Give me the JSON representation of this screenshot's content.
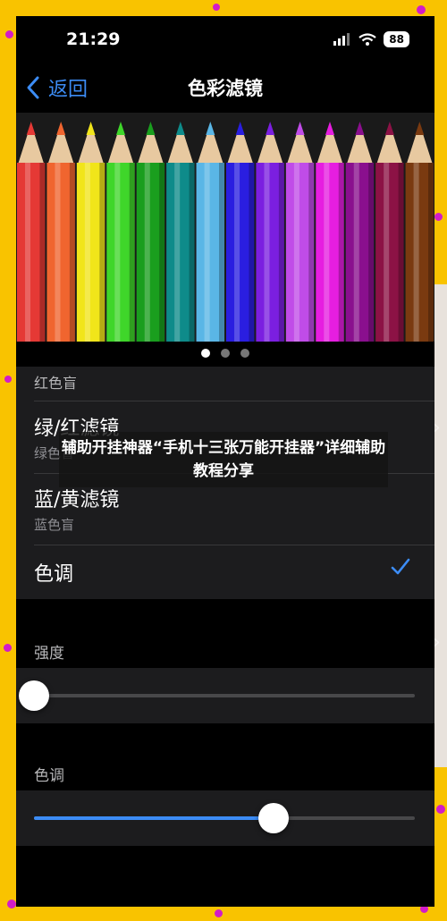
{
  "status_bar": {
    "time": "21:29",
    "battery": "88"
  },
  "nav": {
    "back_label": "返回",
    "title": "色彩滤镜"
  },
  "carousel": {
    "pencil_colors": [
      "#e53935",
      "#f0652f",
      "#f1e51a",
      "#3fd62a",
      "#1a9e1e",
      "#0e8b8a",
      "#5ab6e6",
      "#2a1ee0",
      "#7b1fe0",
      "#c04ce8",
      "#e61ee0",
      "#8a0f8e",
      "#8c1245",
      "#7a3a10"
    ],
    "page_count": 3,
    "active_page": 1
  },
  "options": [
    {
      "title": "",
      "subtitle": "红色盲",
      "selected": false
    },
    {
      "title": "绿/红滤镜",
      "subtitle": "绿色盲",
      "selected": false
    },
    {
      "title": "蓝/黄滤镜",
      "subtitle": "蓝色盲",
      "selected": false
    },
    {
      "title": "色调",
      "subtitle": "",
      "selected": true
    }
  ],
  "sliders": {
    "intensity": {
      "label": "强度",
      "value": 0.0
    },
    "hue": {
      "label": "色调",
      "value": 0.63
    }
  },
  "overlay_banner": "辅助开挂神器“手机十三张万能开挂器”详细辅助教程分享",
  "colors": {
    "accent": "#3c8cf5",
    "frame": "#f9c300",
    "confetti": "#d21cc8"
  }
}
